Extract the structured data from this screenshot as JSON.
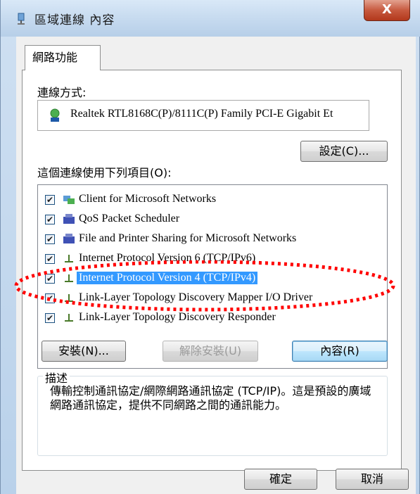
{
  "window": {
    "title": "區域連線 內容",
    "close_label": "X"
  },
  "tab": {
    "label": "網路功能"
  },
  "connect_using": {
    "label": "連線方式:",
    "adapter_name": "Realtek RTL8168C(P)/8111C(P) Family PCI-E Gigabit Et",
    "configure_button": "設定(C)..."
  },
  "items_section": {
    "label": "這個連線使用下列項目(O):",
    "items": [
      {
        "label": "Client for Microsoft Networks",
        "checked": "✔",
        "icon": "network-client-icon"
      },
      {
        "label": "QoS Packet Scheduler",
        "checked": "✔",
        "icon": "service-icon"
      },
      {
        "label": "File and Printer Sharing for Microsoft Networks",
        "checked": "✔",
        "icon": "service-icon"
      },
      {
        "label": "Internet Protocol Version 6 (TCP/IPv6)",
        "checked": "✔",
        "icon": "protocol-icon"
      },
      {
        "label": "Internet Protocol Version 4 (TCP/IPv4)",
        "checked": "✔",
        "icon": "protocol-icon",
        "selected": true
      },
      {
        "label": "Link-Layer Topology Discovery Mapper I/O Driver",
        "checked": "✔",
        "icon": "protocol-icon"
      },
      {
        "label": "Link-Layer Topology Discovery Responder",
        "checked": "✔",
        "icon": "protocol-icon"
      }
    ]
  },
  "buttons": {
    "install": "安裝(N)...",
    "uninstall": "解除安裝(U)",
    "properties": "內容(R)",
    "ok": "確定",
    "cancel": "取消"
  },
  "description": {
    "legend": "描述",
    "text": "傳輸控制通訊協定/網際網路通訊協定 (TCP/IP)。這是預設的廣域網路通訊協定，提供不同網路之間的通訊能力。"
  },
  "colors": {
    "highlight": "#3399ff",
    "annotation": "#ff0000"
  }
}
